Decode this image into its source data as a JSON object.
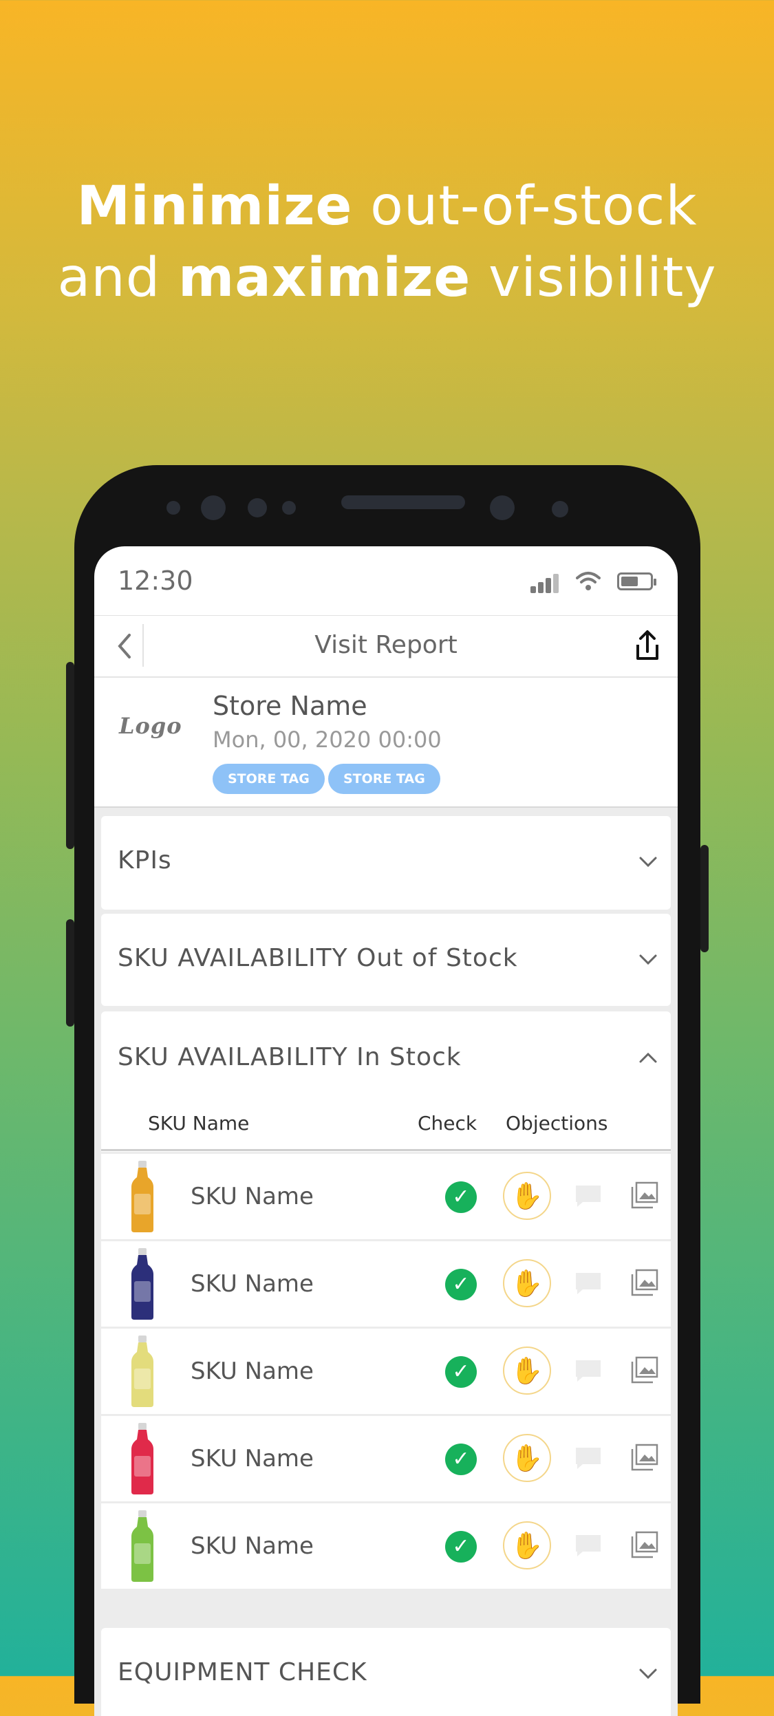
{
  "headline": {
    "line1_bold": "Minimize",
    "line1_rest": " out-of-stock",
    "line2_start": "and ",
    "line2_bold": "maximize",
    "line2_rest": " visibility"
  },
  "statusbar": {
    "time": "12:30"
  },
  "navbar": {
    "title": "Visit Report"
  },
  "store": {
    "logo": "Logo",
    "name": "Store Name",
    "date": "Mon, 00, 2020 00:00",
    "tags": [
      "STORE TAG",
      "STORE TAG"
    ]
  },
  "sections": {
    "kpis": "KPIs",
    "out_of_stock": "SKU AVAILABILITY Out of Stock",
    "in_stock": "SKU AVAILABILITY In Stock",
    "equipment": "EQUIPMENT CHECK"
  },
  "table": {
    "headers": {
      "sku": "SKU Name",
      "check": "Check",
      "objections": "Objections"
    },
    "rows": [
      {
        "name": "SKU Name",
        "bottle_color": "#e8a52a",
        "cap_color": "#d6d6d6"
      },
      {
        "name": "SKU Name",
        "bottle_color": "#2c2f7a",
        "cap_color": "#d6d6d6"
      },
      {
        "name": "SKU Name",
        "bottle_color": "#e3dc7c",
        "cap_color": "#d6d6d6"
      },
      {
        "name": "SKU Name",
        "bottle_color": "#e02a4a",
        "cap_color": "#d6d6d6"
      },
      {
        "name": "SKU Name",
        "bottle_color": "#7cc244",
        "cap_color": "#d6d6d6"
      }
    ]
  },
  "colors": {
    "check": "#17b15b",
    "tag": "#8ec2f7",
    "objection": "#f6c94f"
  }
}
